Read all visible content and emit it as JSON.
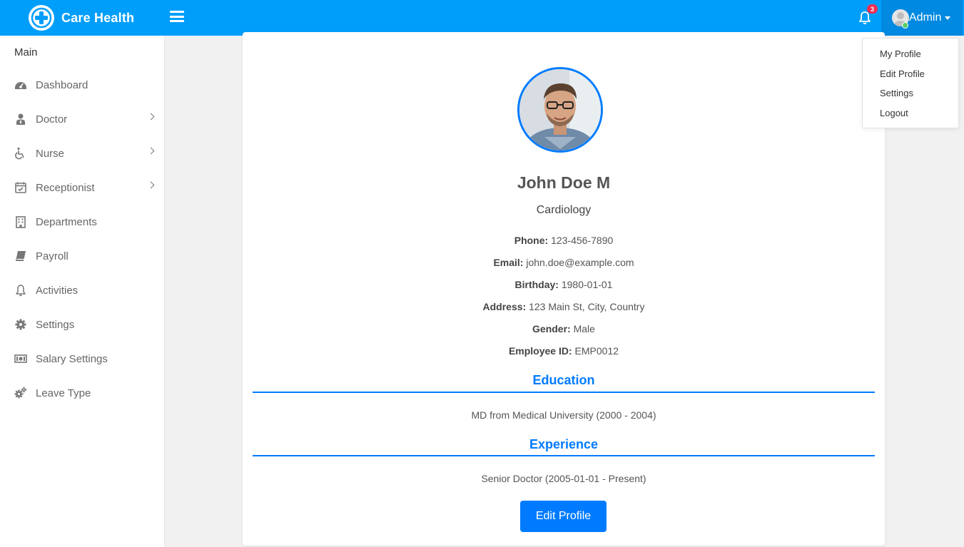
{
  "header": {
    "brand": "Care Health",
    "notification_count": "3",
    "user_name": "Admin",
    "accent_color": "#009efb"
  },
  "sidebar": {
    "title": "Main",
    "items": [
      {
        "label": "Dashboard",
        "icon": "dashboard-icon",
        "has_submenu": false
      },
      {
        "label": "Doctor",
        "icon": "doctor-icon",
        "has_submenu": true
      },
      {
        "label": "Nurse",
        "icon": "wheelchair-icon",
        "has_submenu": true
      },
      {
        "label": "Receptionist",
        "icon": "calendar-check-icon",
        "has_submenu": true
      },
      {
        "label": "Departments",
        "icon": "building-icon",
        "has_submenu": false
      },
      {
        "label": "Payroll",
        "icon": "book-icon",
        "has_submenu": false
      },
      {
        "label": "Activities",
        "icon": "bell-icon",
        "has_submenu": false
      },
      {
        "label": "Settings",
        "icon": "gear-icon",
        "has_submenu": false
      },
      {
        "label": "Salary Settings",
        "icon": "money-icon",
        "has_submenu": false
      },
      {
        "label": "Leave Type",
        "icon": "gears-icon",
        "has_submenu": false
      }
    ]
  },
  "profile": {
    "name": "John Doe M",
    "department": "Cardiology",
    "fields": [
      {
        "label": "Phone:",
        "value": "123-456-7890"
      },
      {
        "label": "Email:",
        "value": "john.doe@example.com"
      },
      {
        "label": "Birthday:",
        "value": "1980-01-01"
      },
      {
        "label": "Address:",
        "value": "123 Main St, City, Country"
      },
      {
        "label": "Gender:",
        "value": "Male"
      },
      {
        "label": "Employee ID:",
        "value": "EMP0012"
      }
    ],
    "education_title": "Education",
    "education_text": "MD from Medical University (2000 - 2004)",
    "experience_title": "Experience",
    "experience_text": "Senior Doctor (2005-01-01 - Present)",
    "edit_button": "Edit Profile"
  },
  "dropdown": {
    "items": [
      "My Profile",
      "Edit Profile",
      "Settings",
      "Logout"
    ]
  }
}
